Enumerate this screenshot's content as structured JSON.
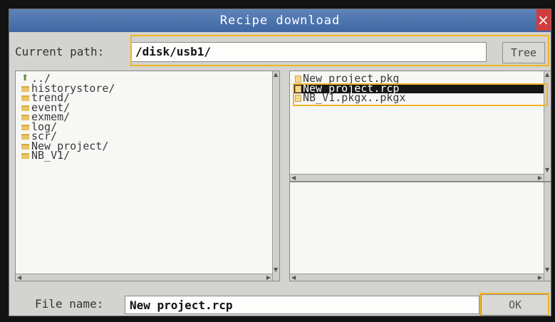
{
  "window": {
    "title": "Recipe download",
    "close_glyph": "×"
  },
  "path": {
    "label": "Current path:",
    "value": "/disk/usb1/",
    "tree_button": "Tree"
  },
  "folders": [
    {
      "label": "../",
      "icon": "up-folder-icon"
    },
    {
      "label": "historystore/",
      "icon": "folder-icon"
    },
    {
      "label": "trend/",
      "icon": "folder-icon"
    },
    {
      "label": "event/",
      "icon": "folder-icon"
    },
    {
      "label": "exmem/",
      "icon": "folder-icon"
    },
    {
      "label": "log/",
      "icon": "folder-icon"
    },
    {
      "label": "scr/",
      "icon": "folder-icon"
    },
    {
      "label": "New project/",
      "icon": "folder-icon"
    },
    {
      "label": "NB_V1/",
      "icon": "folder-icon"
    }
  ],
  "files": [
    {
      "label": "New project.pkg",
      "selected": false
    },
    {
      "label": "New project.rcp",
      "selected": true
    },
    {
      "label": "NB_V1.pkgx..pkgx",
      "selected": false
    }
  ],
  "footer": {
    "file_name_label": "File name:",
    "file_name_value": "New project.rcp",
    "ok_button": "OK"
  },
  "colors": {
    "highlight": "#f0b424",
    "titlebar": "#4a72ad",
    "selection": "#161616"
  }
}
